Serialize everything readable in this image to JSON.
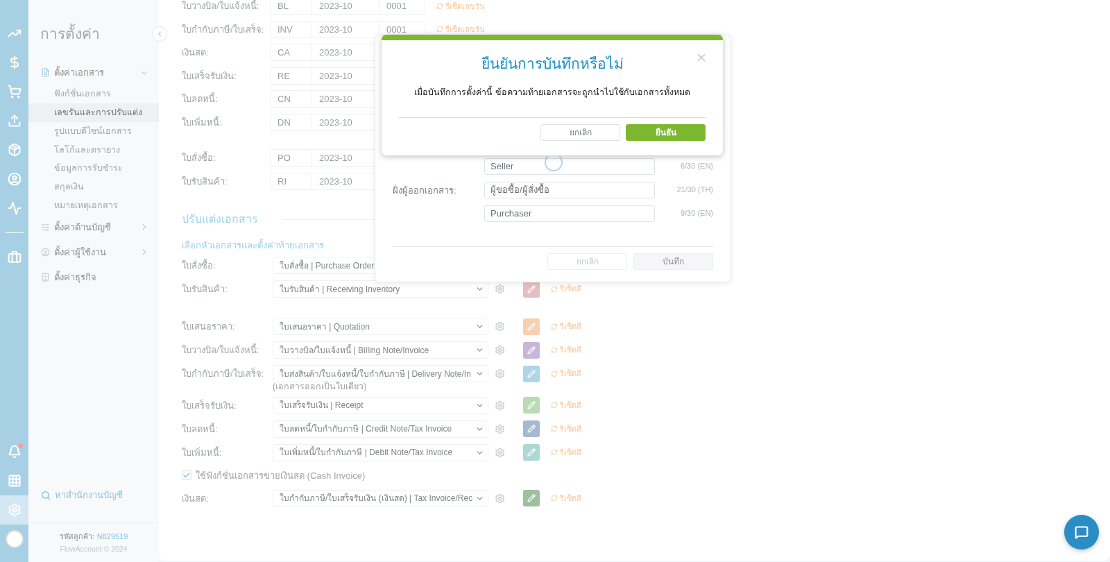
{
  "rail": {
    "items": [
      {
        "kind": "chart",
        "selected": false
      },
      {
        "kind": "dollar",
        "selected": false
      },
      {
        "kind": "cart",
        "selected": false
      },
      {
        "kind": "upload",
        "selected": false
      },
      {
        "kind": "box",
        "selected": false
      },
      {
        "kind": "user",
        "selected": false
      },
      {
        "kind": "monitor",
        "selected": false
      }
    ],
    "middle": [
      {
        "kind": "briefcase",
        "selected": false
      }
    ],
    "bottom": [
      {
        "kind": "bell",
        "selected": false
      },
      {
        "kind": "grid",
        "selected": false
      },
      {
        "kind": "settings",
        "selected": true
      },
      {
        "kind": "logo",
        "selected": false
      }
    ]
  },
  "sidebar": {
    "title": "การตั้งค่า",
    "groups": [
      {
        "label": "ตั้งค่าเอกสาร",
        "kind": "document",
        "expanded": true,
        "children": [
          {
            "label": "ฟังก์ชั่นเอกสาร",
            "selected": false
          },
          {
            "label": "เลขรันและการปรับแต่ง",
            "selected": true
          },
          {
            "label": "รูปแบบดีไซน์เอกสาร",
            "selected": false
          },
          {
            "label": "โลโก้และตรายาง",
            "selected": false
          },
          {
            "label": "ข้อมูลการรับชำระ",
            "selected": false
          },
          {
            "label": "สกุลเงิน",
            "selected": false
          },
          {
            "label": "หมายเหตุเอกสาร",
            "selected": false
          }
        ]
      },
      {
        "label": "ตั้งค่าด้านบัญชี",
        "kind": "sliders",
        "expanded": false
      },
      {
        "label": "ตั้งค่าผู้ใช้งาน",
        "kind": "user",
        "expanded": false
      },
      {
        "label": "ตั้งค่าธุรกิจ",
        "kind": "building"
      }
    ],
    "search_link": "หาสำนักงานบัญชี",
    "customer_code_label": "รหัสลูกค้า:",
    "customer_code": "N829519",
    "copyright": "FlowAccount © 2024"
  },
  "numbering": [
    {
      "rows": [
        {
          "label": "ใบวางบิล/ใบแจ้งหนี้:",
          "prefix": "BL",
          "period": "2023-10",
          "number": "0001",
          "reset": "รีเซ็ตเลขรัน"
        },
        {
          "label": "ใบกำกับภาษี/ใบเสร็จ:",
          "prefix": "INV",
          "period": "2023-10",
          "number": "0001",
          "reset": "รีเซ็ตเลขรัน"
        },
        {
          "label": "เงินสด:",
          "prefix": "CA",
          "period": "2023-10"
        },
        {
          "label": "ใบเสร็จรับเงิน:",
          "prefix": "RE",
          "period": "2023-10"
        },
        {
          "label": "ใบลดหนี้:",
          "prefix": "CN",
          "period": "2023-10"
        },
        {
          "label": "ใบเพิ่มหนี้:",
          "prefix": "DN",
          "period": "2023-10"
        }
      ]
    },
    {
      "rows": [
        {
          "label": "ใบสั่งซื้อ:",
          "prefix": "PO",
          "period": "2023-10"
        },
        {
          "label": "ใบรับสินค้า:",
          "prefix": "RI",
          "period": "2023-10"
        }
      ]
    }
  ],
  "customize": {
    "title": "ปรับแต่งเอกสาร",
    "subtitle": "เลือกหัวเอกสารและตั้งค่าท้ายเอกสาร",
    "groups": [
      {
        "rows": [
          {
            "kind": "select",
            "label": "ใบสั่งซื้อ:",
            "value": "ใบสั่งซื้อ | Purchase Order"
          },
          {
            "kind": "select",
            "label": "ใบรับสินค้า:",
            "value": "ใบรับสินค้า | Receiving Inventory",
            "color": "#e3bfc1",
            "reset": "รีเซ็ตสี"
          }
        ]
      },
      {
        "rows": [
          {
            "kind": "select",
            "label": "ใบเสนอราคา:",
            "value": "ใบเสนอราคา | Quotation",
            "color": "#f6d0b0",
            "reset": "รีเซ็ตสี"
          },
          {
            "kind": "select",
            "label": "ใบวางบิล/ใบแจ้งหนี้:",
            "value": "ใบวางบิล/ใบแจ้งหนี้ | Billing Note/Invoice",
            "color": "#c8b6d8",
            "reset": "รีเซ็ตสี"
          },
          {
            "kind": "select",
            "label": "ใบกำกับภาษี/ใบเสร็จ:",
            "value": "ใบส่งสินค้า/ใบแจ้งหนี้/ใบกำกับภาษี | Delivery Note/In",
            "note": "(เอกสารออกเป็นใบเดียว)",
            "color": "#aed5ea",
            "reset": "รีเซ็ตสี"
          },
          {
            "kind": "select",
            "label": "ใบเสร็จรับเงิน:",
            "value": "ใบเสร็จรับเงิน | Receipt",
            "color": "#badcb4",
            "reset": "รีเซ็ตสี"
          },
          {
            "kind": "select",
            "label": "ใบลดหนี้:",
            "value": "ใบลดหนี้/ใบกำกับภาษี | Credit Note/Tax Invoice",
            "color": "#a6b8d4",
            "reset": "รีเซ็ตสี"
          },
          {
            "kind": "select",
            "label": "ใบเพิ่มหนี้:",
            "value": "ใบเพิ่มหนี้/ใบกำกับภาษี | Debit Note/Tax Invoice",
            "color": "#acd9d6",
            "reset": "รีเซ็ตสี"
          },
          {
            "kind": "checkbox",
            "label": "ใช้ฟังก์ชั่นเอกสารขายเงินสด (Cash Invoice)",
            "checked": true
          },
          {
            "kind": "select",
            "label": "เงินสด:",
            "value": "ใบกำกับภาษี/ใบเสร็จรับเงิน (เงินสด) | Tax Invoice/Rec",
            "color": "#9ec0a0",
            "reset": "รีเซ็ตสี"
          }
        ]
      }
    ]
  },
  "party_dialog": {
    "fields": [
      {
        "value": "Seller",
        "count": "6/30 (EN)",
        "loading": true
      },
      {
        "label": "ฝั่งผู้ออกเอกสาร:",
        "value": "ผู้ขอซื้อ/ผู้สั่งซื้อ",
        "count": "21/30 (TH)",
        "loading": false
      },
      {
        "value": "Purchaser",
        "count": "9/30 (EN)",
        "loading": false
      }
    ],
    "buttons": [
      {
        "label": "ยกเลิก",
        "kind": "secondary"
      },
      {
        "label": "บันทึก",
        "kind": "primary"
      }
    ]
  },
  "confirm_dialog": {
    "title": "ยืนยันการบันทึกหรือไม่",
    "message": "เมื่อบันทึกการตั้งค่านี้ ข้อความท้ายเอกสารจะถูกนำไปใช้กับเอกสารทั้งหมด",
    "buttons": [
      {
        "label": "ยกเลิก",
        "kind": "secondary"
      },
      {
        "label": "ยืนยัน",
        "kind": "primary"
      }
    ]
  }
}
